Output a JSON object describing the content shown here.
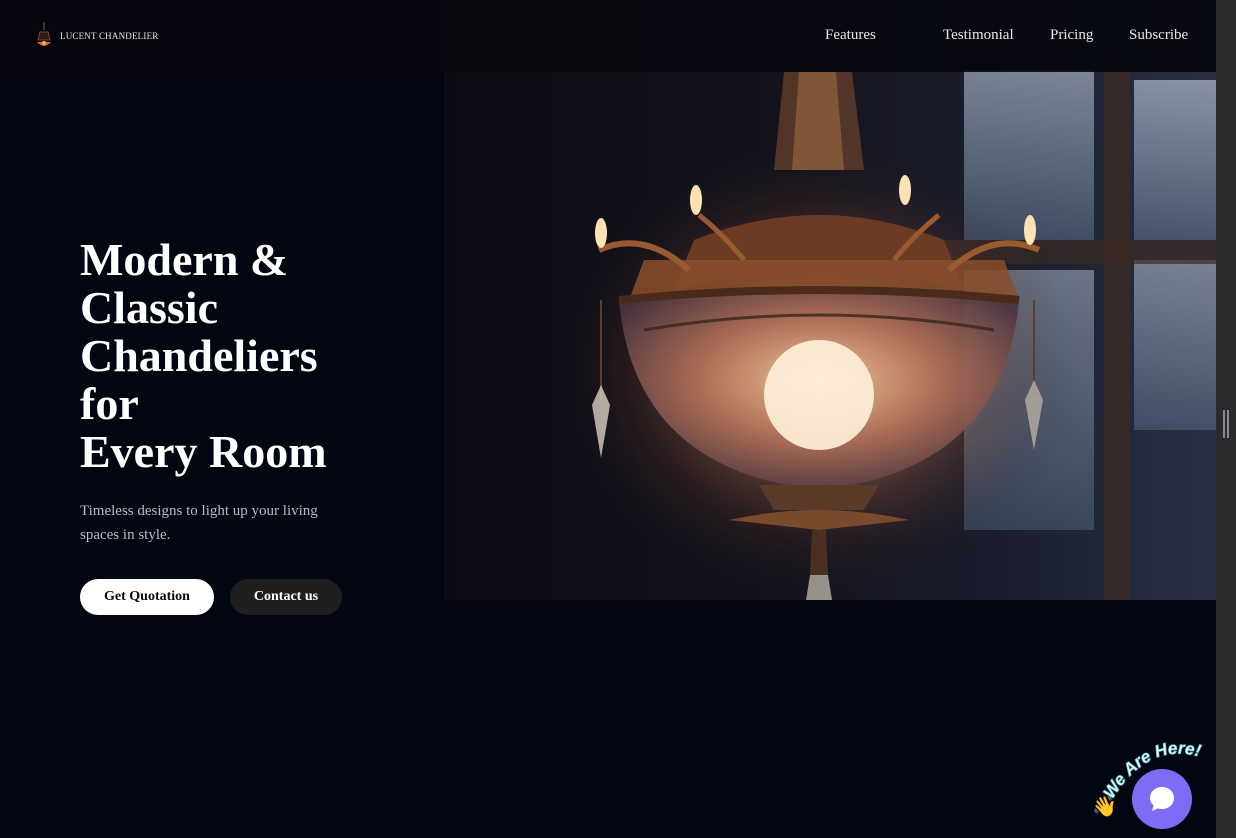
{
  "brand": {
    "name": "LUCENT CHANDELIER"
  },
  "nav": {
    "items": [
      {
        "label": "Features"
      },
      {
        "label": "Testimonial"
      },
      {
        "label": "Pricing"
      },
      {
        "label": "Subscribe"
      }
    ]
  },
  "hero": {
    "title_lines": [
      "Modern &",
      "Classic",
      "Chandeliers",
      "for",
      "Every Room"
    ],
    "subtitle": "Timeless designs to light up your living spaces in style.",
    "primary_button": "Get Quotation",
    "secondary_button": "Contact us",
    "image_alt_icon": "chandelier-photo"
  },
  "chat_widget": {
    "tagline": "We Are Here!",
    "wave_emoji": "👋",
    "icon": "chat-bubble-icon",
    "accent": "#7e6cf4"
  },
  "colors": {
    "background": "#010611",
    "header": "#06080e",
    "primary_button_bg": "#ffffff",
    "secondary_button_bg": "#1f1f22"
  }
}
